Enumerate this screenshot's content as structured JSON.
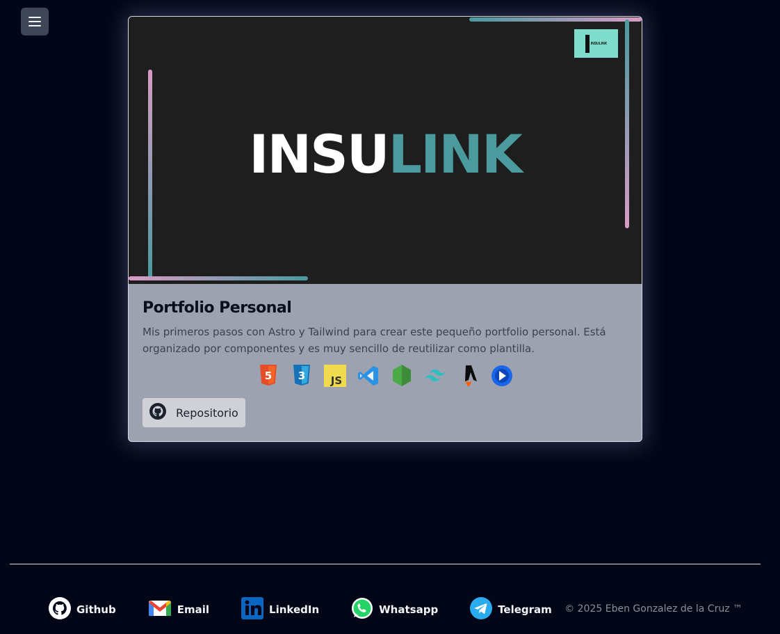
{
  "menu": {
    "icon": "hamburger-icon"
  },
  "project": {
    "banner": {
      "title_part1": "INSU",
      "title_part2": "LINK",
      "mini_logo_text": "INSULINK",
      "accent_teal": "#4a9a9e",
      "accent_pink": "#d89bc6"
    },
    "title": "Portfolio Personal",
    "description": "Mis primeros pasos con Astro y Tailwind para crear este pequeño portfolio personal. Está organizado por componentes y es muy sencillo de reutilizar como plantilla.",
    "technologies": [
      {
        "name": "html5-icon",
        "label": "5",
        "color": "#e44d26"
      },
      {
        "name": "css3-icon",
        "label": "3",
        "color": "#1c6cea"
      },
      {
        "name": "javascript-icon",
        "label": "JS",
        "color": "#f0db4f"
      },
      {
        "name": "vscode-icon",
        "label": "",
        "color": "#2a92e5"
      },
      {
        "name": "nodejs-icon",
        "label": "",
        "color": "#4ca947"
      },
      {
        "name": "tailwind-icon",
        "label": "",
        "color": "#2fbdc1"
      },
      {
        "name": "astro-icon",
        "label": "",
        "color": "#000000"
      },
      {
        "name": "powerpoint-icon",
        "label": "",
        "color": "#1a67ea"
      }
    ],
    "repo_button": {
      "label": "Repositorio",
      "icon": "github-icon"
    }
  },
  "footer": {
    "links": [
      {
        "label": "Github",
        "icon": "github-icon"
      },
      {
        "label": "Email",
        "icon": "gmail-icon"
      },
      {
        "label": "LinkedIn",
        "icon": "linkedin-icon"
      },
      {
        "label": "Whatsapp",
        "icon": "whatsapp-icon"
      },
      {
        "label": "Telegram",
        "icon": "telegram-icon"
      }
    ],
    "copyright": "© 2025 Eben Gonzalez de la Cruz ™"
  }
}
